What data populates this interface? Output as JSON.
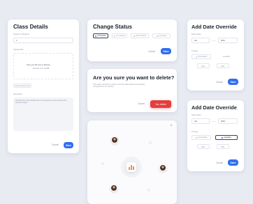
{
  "class_details": {
    "title": "Class Details",
    "name_label": "Number of Students",
    "name_value": "2",
    "upload_label": "Upload Files",
    "upload_hint": "Drop your file here or Browse",
    "upload_sub": "Max file size: 10 MB",
    "tag_label": "Upload Attachment",
    "desc_label": "Description",
    "desc_placeholder": "Describe the class details here for students to review before the session begins.",
    "cancel_label": "Cancel",
    "save_label": "Save"
  },
  "change_status": {
    "title": "Change Status",
    "options": [
      "Scheduled",
      "Completed",
      "Rescheduled",
      "Cancelled"
    ],
    "cancel_label": "Cancel",
    "save_label": "Save"
  },
  "delete_dialog": {
    "title": "Are you sure you want to delete?",
    "body": "This action cannot be undone. All of the data will be permanently removed from our servers.",
    "cancel_label": "Cancel",
    "delete_label": "Yes, delete"
  },
  "add_date_override_1": {
    "title": "Add Date Override",
    "date_label": "Select Date",
    "date_value": "Jan",
    "year_value": "2024",
    "time_label": "Timings",
    "from_label": "Unavailable",
    "to_label": "Available",
    "start_value": "9:00",
    "end_value": "5:00",
    "cancel_label": "Cancel",
    "save_label": "Save"
  },
  "add_date_override_2": {
    "title": "Add Date Override",
    "date_label": "Select Date",
    "date_value": "Jan",
    "year_value": "2024",
    "time_label": "Timings",
    "from_label": "Unavailable",
    "to_label": "Available",
    "start_value": "9:00",
    "end_value": "5:00",
    "cancel_label": "Cancel",
    "save_label": "Save"
  },
  "network": {
    "close_icon": "close-icon",
    "center_icon": "chart-icon"
  },
  "colors": {
    "primary": "#2f6ef0",
    "danger": "#e53e3e",
    "background": "#e9ebf3"
  }
}
